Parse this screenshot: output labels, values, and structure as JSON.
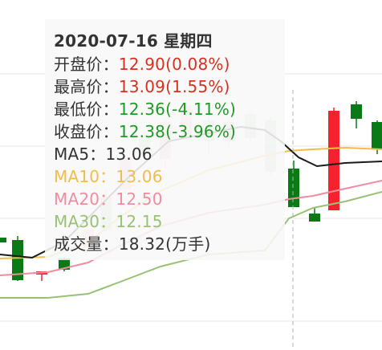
{
  "tooltip": {
    "date_line": "2020-07-16 星期四",
    "rows": [
      {
        "label": "开盘价：",
        "value": "12.90(0.08%)",
        "label_color": "#333333",
        "value_color": "#d7301f"
      },
      {
        "label": "最高价：",
        "value": "13.09(1.55%)",
        "label_color": "#333333",
        "value_color": "#d7301f"
      },
      {
        "label": "最低价：",
        "value": "12.36(-4.11%)",
        "label_color": "#333333",
        "value_color": "#1f9a26"
      },
      {
        "label": "收盘价：",
        "value": "12.38(-3.96%)",
        "label_color": "#333333",
        "value_color": "#1f9a26"
      },
      {
        "label": "MA5：",
        "value": "13.06",
        "label_color": "#333333",
        "value_color": "#333333"
      },
      {
        "label": "MA10：",
        "value": "13.06",
        "label_color": "#f2bc4a",
        "value_color": "#f2bc4a"
      },
      {
        "label": "MA20：",
        "value": "12.50",
        "label_color": "#ee8da0",
        "value_color": "#ee8da0"
      },
      {
        "label": "MA30：",
        "value": "12.15",
        "label_color": "#98c273",
        "value_color": "#98c273"
      },
      {
        "label": "成交量：",
        "value": "18.32(万手)",
        "label_color": "#333333",
        "value_color": "#333333"
      }
    ]
  },
  "colors": {
    "up": "#f5222d",
    "down": "#0a7a16",
    "ma5": "#1a1a1a",
    "ma10": "#f2bc4a",
    "ma20": "#ee8da0",
    "ma30": "#98c273",
    "grid": "#e6e6e6",
    "crosshair": "#b0b0b0"
  }
}
